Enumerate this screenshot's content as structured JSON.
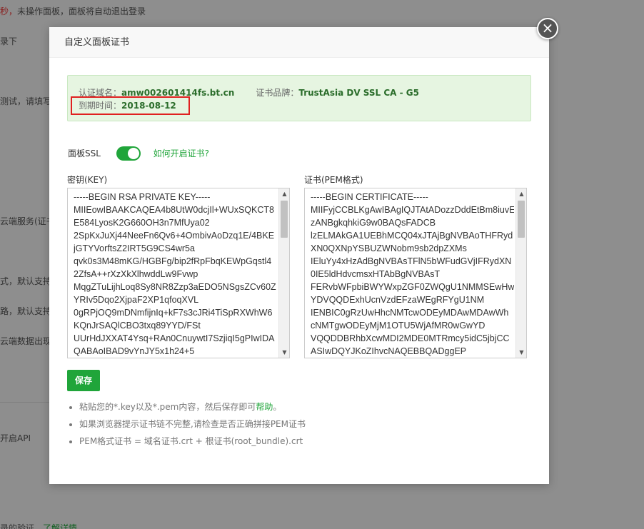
{
  "background": {
    "lines": [
      {
        "text_red": "秒，",
        "text": "未操作面板，面板将自动退出登录"
      },
      {
        "text": "录下"
      },
      {
        "text": "测试，请填写"
      },
      {
        "text": "云端服务(证书"
      },
      {
        "text": "式，默认支持"
      },
      {
        "text": "路，默认支持"
      },
      {
        "text": "云端数据出现"
      },
      {
        "text": "开启API"
      },
      {
        "text": "录的验证，",
        "link": "了解详情"
      }
    ]
  },
  "modal": {
    "title": "自定义面板证书",
    "close_symbol": "×",
    "info": {
      "domain_label": "认证域名：",
      "domain_value": "amw002601414fs.bt.cn",
      "brand_label": "证书品牌：",
      "brand_value": "TrustAsia DV SSL CA - G5",
      "expiry_label": "到期时间：",
      "expiry_value": "2018-08-12"
    },
    "ssl": {
      "label": "面板SSL",
      "enabled": true,
      "help_link": "如何开启证书?"
    },
    "key_field": {
      "label": "密钥(KEY)",
      "lines": [
        "-----BEGIN RSA PRIVATE KEY-----",
        "MIIEowIBAAKCAQEA4b8UtW0dcjIl+WUxSQKCT8",
        "E584LyosK2G660OH3n7MfUya02",
        "2SpKxJuXj44NeeFn6Qv6+4OmbivAoDzq1E/4BKE",
        "jGTYVorftsZ2IRT5G9CS4wr5a",
        "qvk0s3M48mKG/HGBFg/bip2fRpFbqKEWpGqstl4",
        "2ZfsA++rXzXkXlhwddLw9Fvwp",
        "MqgZTuLijhLoq8Sy8NR8Zzp3aEDO5NSgsZCv60Z",
        "YRIv5Dqo2XjpaF2XP1qfoqXVL",
        "0gRPjOQ9mDNmfijnIq+kF7s3cJRi4TiSpRXWhW6",
        "KQnJrSAQlCBO3txq89YYD/FSt",
        "UUrHdJXXAT4Ysq+RAn0CnuywtI7SzjiqI5gPIwIDA",
        "QABAoIBAD9vYnJY5x1h24+5"
      ]
    },
    "cert_field": {
      "label": "证书(PEM格式)",
      "lines": [
        "-----BEGIN CERTIFICATE-----",
        "MIIFyjCCBLKgAwIBAgIQJTAtADozzDddEtBm8iuvE",
        "zANBgkqhkiG9w0BAQsFADCB",
        "lzELMAkGA1UEBhMCQ04xJTAjBgNVBAoTHFRyd",
        "XN0QXNpYSBUZWNobm9sb2dpZXMs",
        "IEluYy4xHzAdBgNVBAsTFlN5bWFudGVjIFRydXN",
        "0IE5ldHdvcmsxHTAbBgNVBAsT",
        "FERvbWFpbiBWYWxpZGF0ZWQgU1NMMSEwHw",
        "YDVQQDExhUcnVzdEFzaWEgRFYgU1NM",
        "IENBIC0gRzUwHhcNMTcwODEyMDAwMDAwWh",
        "cNMTgwODEyMjM1OTU5WjAfMR0wGwYD",
        "VQQDDBRhbXcwMDI2MDE0MTRmcy5idC5jbjCC",
        "ASIwDQYJKoZIhvcNAQEBBQADggEP"
      ]
    },
    "save_label": "保存",
    "tips": [
      {
        "text": "粘贴您的*.key以及*.pem内容，然后保存即可",
        "link": "帮助",
        "suffix": "。"
      },
      {
        "text": "如果浏览器提示证书链不完整,请检查是否正确拼接PEM证书"
      },
      {
        "text": "PEM格式证书 = 域名证书.crt + 根证书(root_bundle).crt"
      }
    ]
  },
  "colors": {
    "accent": "#20a53a",
    "highlight_frame": "#e02020",
    "info_bg": "#e6f5e1"
  },
  "icons": {
    "close": "close-icon",
    "scroll_up": "scroll-up-icon",
    "scroll_down": "scroll-down-icon"
  }
}
